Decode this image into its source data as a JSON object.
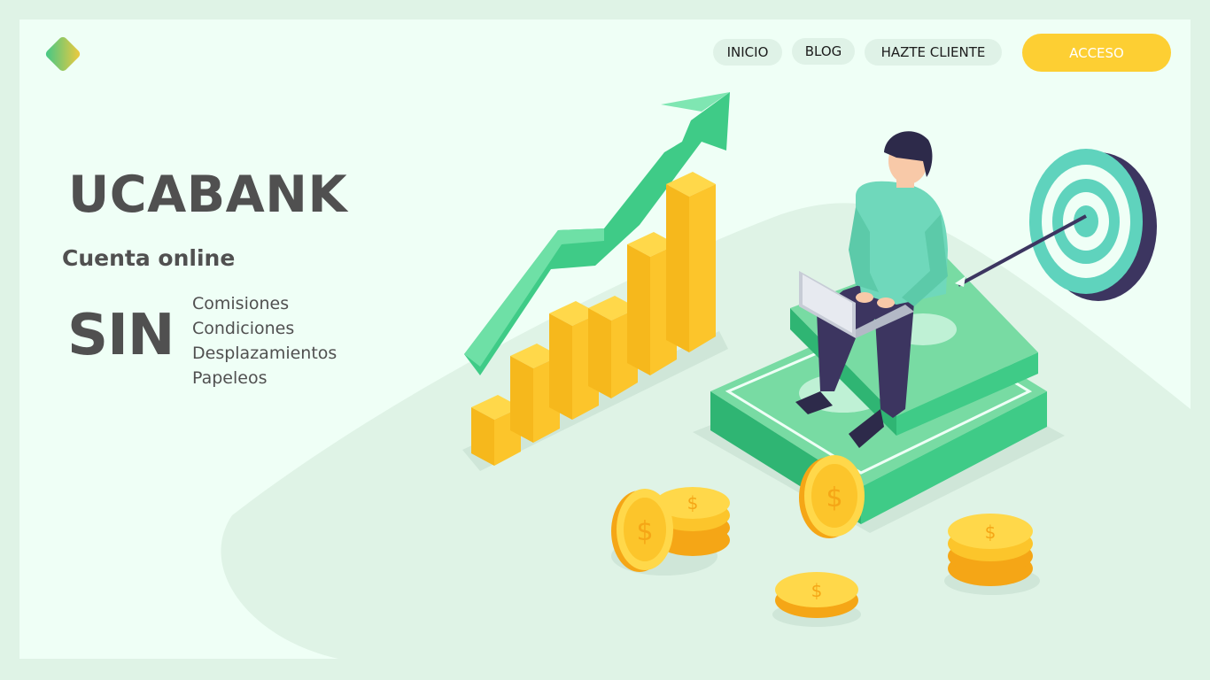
{
  "nav": {
    "items": [
      {
        "label": "INICIO"
      },
      {
        "label": "BLOG"
      },
      {
        "label": "HAZTE CLIENTE"
      }
    ],
    "access_label": "ACCESO"
  },
  "hero": {
    "brand": "UCABANK",
    "subtitle": "Cuenta online",
    "sin": "SIN",
    "features": [
      "Comisiones",
      "Condiciones",
      "Desplazamientos",
      "Papeleos"
    ]
  },
  "colors": {
    "background": "#dff3e6",
    "card": "#effff6",
    "accent_yellow": "#fdcf33",
    "text_dark": "#505050",
    "green": "#3fcb87"
  }
}
